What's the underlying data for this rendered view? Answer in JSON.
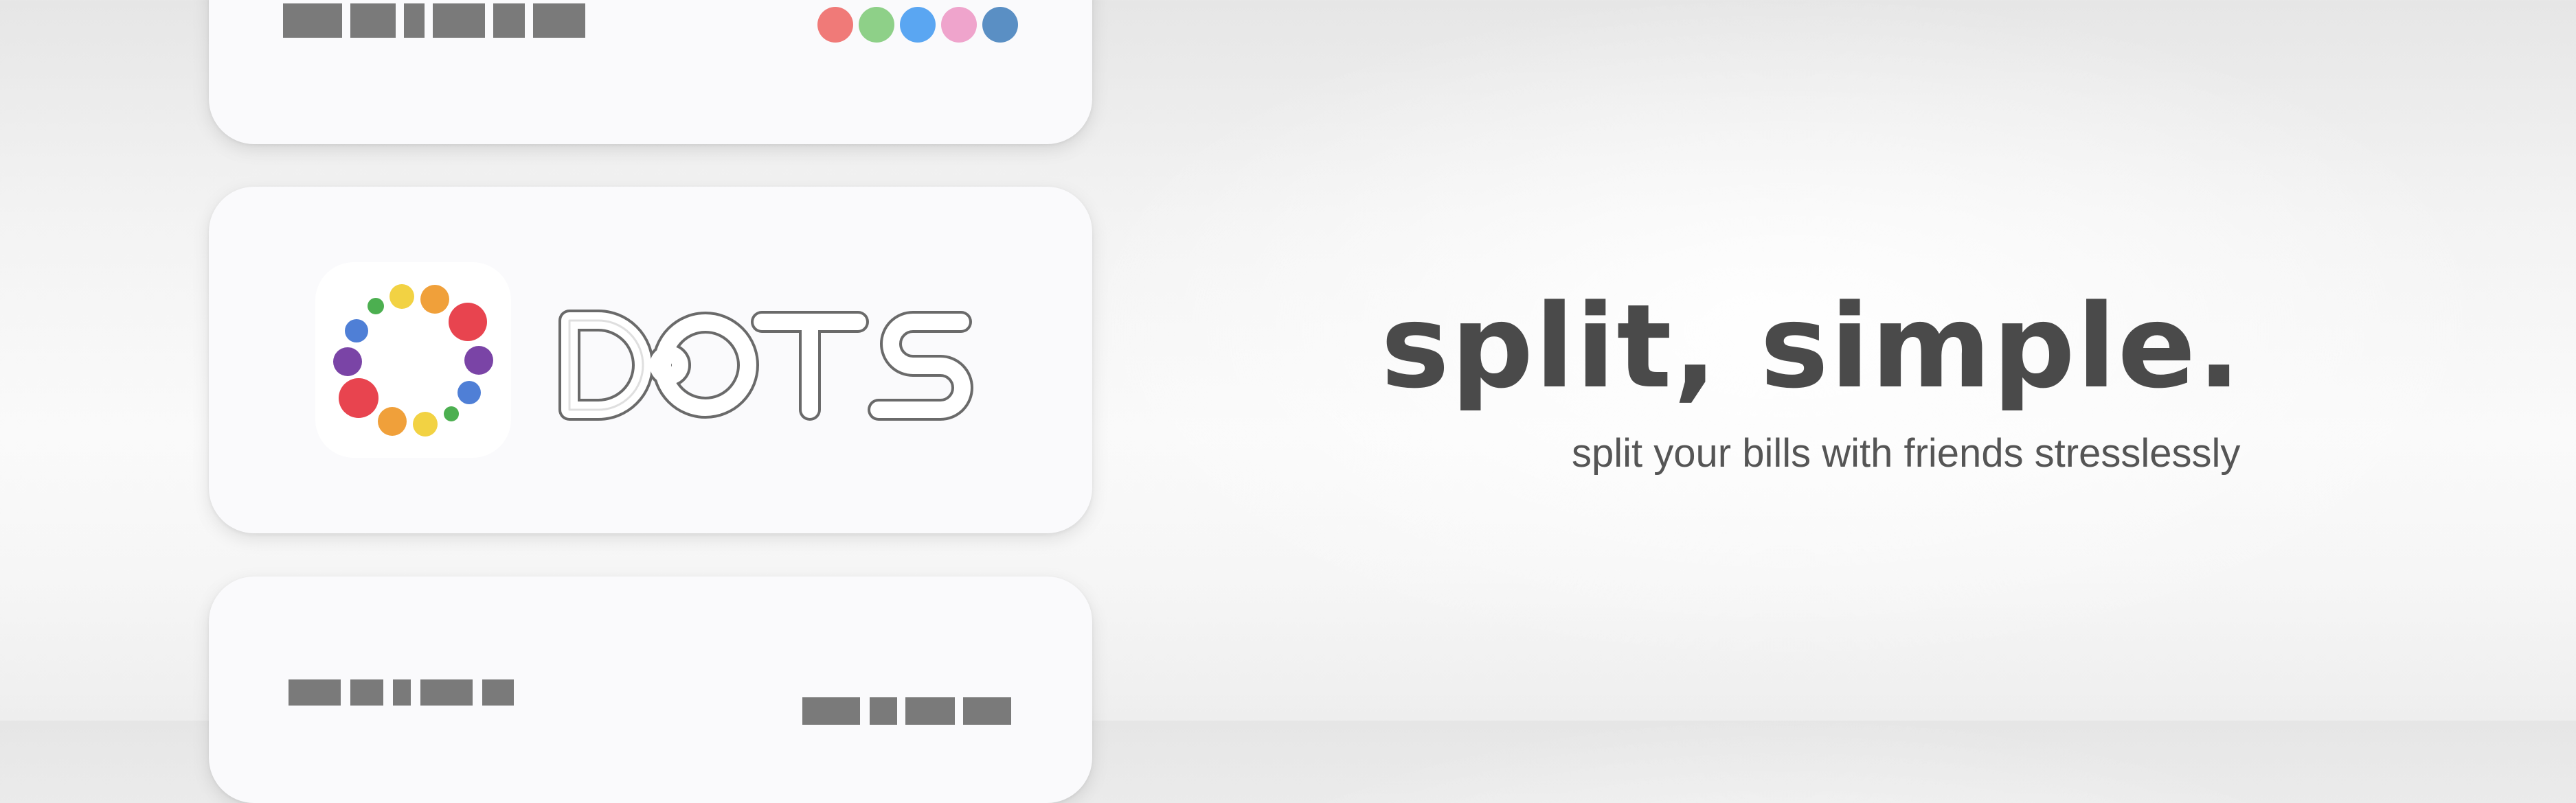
{
  "hero": {
    "headline": "split, simple.",
    "tagline": "split your bills with friends stresslessly"
  },
  "brand": {
    "wordmark": "DOTS",
    "icon": "dots-ring-logo"
  },
  "top_card": {
    "color_dots": [
      "#f07a78",
      "#8ed088",
      "#5aa6f2",
      "#efa4cc",
      "#5a8fc4"
    ]
  },
  "colors": {
    "headline": "#4a4a4a",
    "card_background": "#fafafc",
    "placeholder_bar": "#7a7a7a"
  }
}
